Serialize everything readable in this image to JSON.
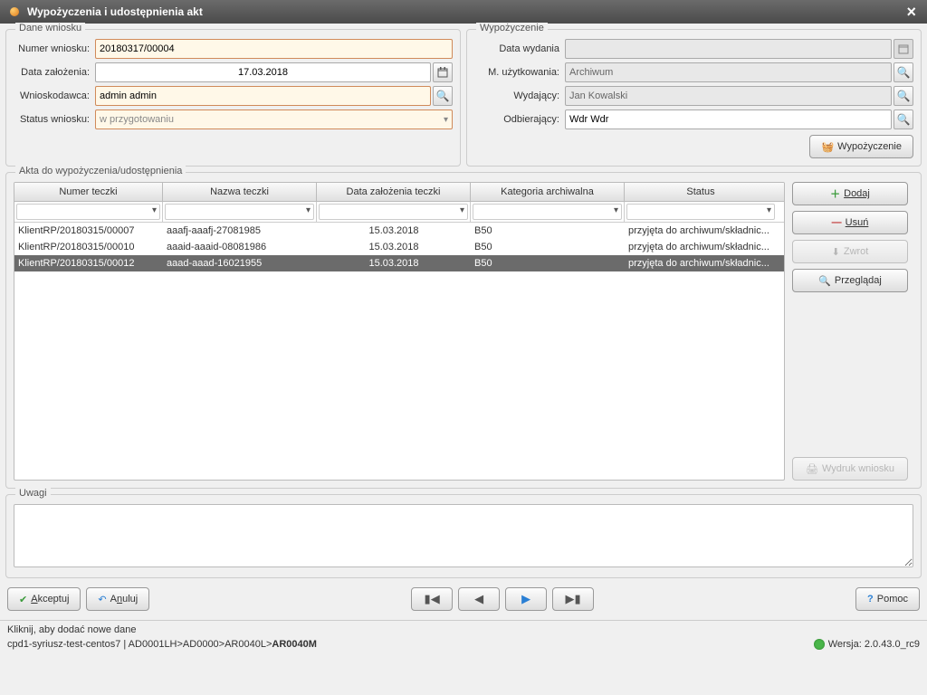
{
  "window": {
    "title": "Wypożyczenia i udostępnienia akt"
  },
  "dane": {
    "legend": "Dane wniosku",
    "numer_label": "Numer wniosku:",
    "numer": "20180317/00004",
    "data_label": "Data założenia:",
    "data": "17.03.2018",
    "wniosk_label": "Wnioskodawca:",
    "wniosko": "admin admin",
    "status_label": "Status wniosku:",
    "status": "w przygotowaniu"
  },
  "wypo": {
    "legend": "Wypożyczenie",
    "data_label": "Data wydania",
    "data": "",
    "muz_label": "M. użytkowania:",
    "muz": "Archiwum",
    "wyd_label": "Wydający:",
    "wyd": "Jan Kowalski",
    "odb_label": "Odbierający:",
    "odb": "Wdr Wdr",
    "btn": "Wypożyczenie"
  },
  "akta": {
    "legend": "Akta do wypożyczenia/udostępnienia",
    "cols": {
      "num": "Numer teczki",
      "name": "Nazwa teczki",
      "date": "Data założenia teczki",
      "cat": "Kategoria archiwalna",
      "status": "Status"
    },
    "rows": [
      {
        "num": "KlientRP/20180315/00007",
        "name": "aaafj-aaafj-27081985",
        "date": "15.03.2018",
        "cat": "B50",
        "status": "przyjęta do archiwum/składnic..."
      },
      {
        "num": "KlientRP/20180315/00010",
        "name": "aaaid-aaaid-08081986",
        "date": "15.03.2018",
        "cat": "B50",
        "status": "przyjęta do archiwum/składnic..."
      },
      {
        "num": "KlientRP/20180315/00012",
        "name": "aaad-aaad-16021955",
        "date": "15.03.2018",
        "cat": "B50",
        "status": "przyjęta do archiwum/składnic..."
      }
    ],
    "btn_add": "Dodaj",
    "btn_del": "Usuń",
    "btn_zwrot": "Zwrot",
    "btn_view": "Przeglądaj",
    "btn_print": "Wydruk wniosku"
  },
  "uwagi": {
    "legend": "Uwagi"
  },
  "bottom": {
    "accept": "Akceptuj",
    "cancel": "Anuluj",
    "help": "Pomoc"
  },
  "status1": "Kliknij, aby dodać nowe dane",
  "status2_left": "cpd1-syriusz-test-centos7 | AD0001LH>AD0000>AR0040L>",
  "status2_bold": "AR0040M",
  "status2_right": "Wersja: 2.0.43.0_rc9"
}
